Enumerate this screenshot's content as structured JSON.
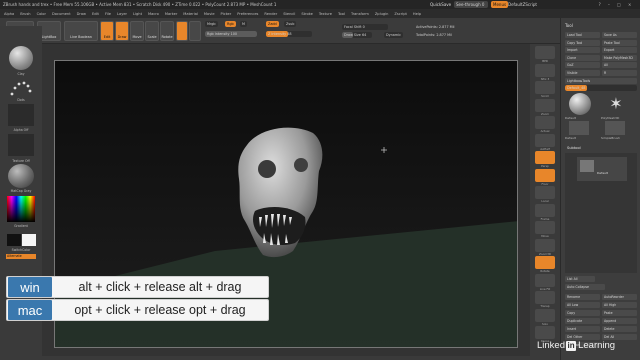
{
  "titlebar": {
    "title": "ZBrush  hands and trex  • Free Mem 55.106GB • Active Mem 831 • Scratch Disk 490 • ZTime 0.022 • PolyCount 2.873 MP • MeshCount 1",
    "quicksave": "QuickSave",
    "seethrough": "See-through  0",
    "menus_btn": "Menus",
    "script": "DefaultZScript"
  },
  "menubar": [
    "Alpha",
    "Brush",
    "Color",
    "Document",
    "Draw",
    "Edit",
    "File",
    "Layer",
    "Light",
    "Macro",
    "Marker",
    "Material",
    "Movie",
    "Picker",
    "Preferences",
    "Render",
    "Stencil",
    "Stroke",
    "Texture",
    "Tool",
    "Transform",
    "Zplugin",
    "Zscript",
    "Help"
  ],
  "topshelf": {
    "buttons": [
      "Home Page",
      "LightBox",
      "Live Boolean",
      "Edit",
      "Draw",
      "Move",
      "Scale",
      "Rotate"
    ],
    "mrgb": "Mrgb",
    "rgb": "Rgb",
    "m": "M",
    "rgb_intensity": "Rgb Intensity 100",
    "zadd": "Zadd",
    "zsub": "Zsub",
    "z_intensity": "Z Intensity 48",
    "focal_shift": "Focal Shift 0",
    "draw_size": "Draw Size 64",
    "dynamic": "Dynamic",
    "active_points": "ActivePoints: 2.877 Mil",
    "total_points": "TotalPoints: 2.877 Mil"
  },
  "leftshelf": {
    "brush": "Clay",
    "stroke": "Dots",
    "alpha": "Alpha Off",
    "texture": "Texture Off",
    "material": "MatCap Gray",
    "gradient": "Gradient",
    "switch_color": "SwitchColor",
    "alternate": "Alternate"
  },
  "rightshelf": [
    "BPR",
    "SPix 3",
    "Scroll",
    "Zoom",
    "Actual",
    "AAHalf",
    "Persp",
    "Floor",
    "Local",
    "Frame",
    "Move",
    "Zoom3D",
    "Rotate",
    "Line Fill",
    "Transp",
    "Solo",
    "Xpose"
  ],
  "toolpanel": {
    "title": "Tool",
    "buttons": [
      "Load Tool",
      "Save As",
      "Copy Tool",
      "Paste Tool",
      "Import",
      "Export",
      "Clone",
      "Make PolyMesh3D",
      "GoZ",
      "All",
      "Visible",
      "R"
    ],
    "lightbox_tools": "Lightbox▸Tools",
    "tool_slider": "Default_48",
    "thumbs": [
      "Default",
      "PolyMesh3D",
      "Default",
      "SimpleBrush"
    ],
    "subtool_title": "Subtool",
    "subtool_name": "Default",
    "list_all": "List All",
    "auto_collapse": "Auto Collapse",
    "buttons2": [
      "Rename",
      "AutoReorder",
      "All Low",
      "All High",
      "Copy",
      "Paste",
      "Duplicate",
      "Append",
      "Insert",
      "Delete",
      "Del Other",
      "Del All",
      "Boolean"
    ]
  },
  "kb": {
    "rows": [
      {
        "os": "win",
        "cmd": "alt + click + release alt + drag"
      },
      {
        "os": "mac",
        "cmd": "opt + click + release opt + drag"
      }
    ]
  },
  "watermark": {
    "pre": "Linked",
    "in": "in",
    "post": "Learning"
  },
  "colors": {
    "accent": "#e8862a",
    "kb_tag": "#3a78ae"
  }
}
